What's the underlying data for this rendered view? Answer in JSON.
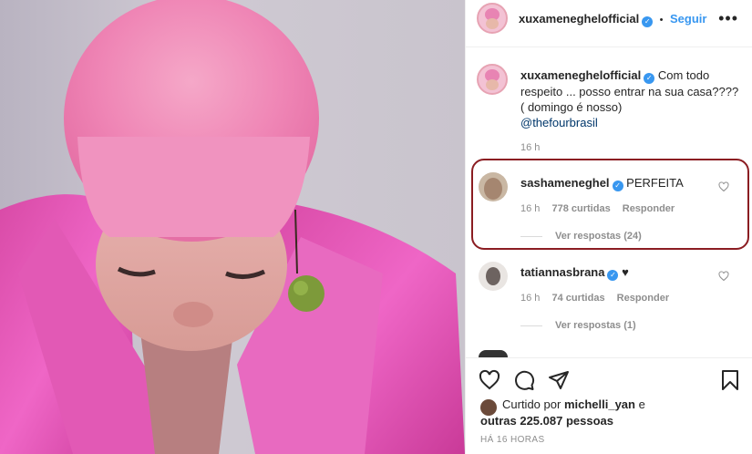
{
  "post": {
    "author": "xuxameneghelofficial",
    "follow_label": "Seguir",
    "more_label": "•••",
    "bullet": "•"
  },
  "caption": {
    "author": "xuxameneghelofficial",
    "text": "Com todo respeito ... posso entrar na sua casa???? ( domingo é nosso)",
    "mention": "@thefourbrasil",
    "time": "16 h"
  },
  "comments": [
    {
      "user": "sashameneghel",
      "verified": true,
      "text": "PERFEITA",
      "time": "16 h",
      "likes": "778 curtidas",
      "reply_label": "Responder",
      "view_replies": "Ver respostas (24)"
    },
    {
      "user": "tatiannasbrana",
      "verified": true,
      "text": "♥",
      "time": "16 h",
      "likes": "74 curtidas",
      "reply_label": "Responder",
      "view_replies": "Ver respostas (1)"
    }
  ],
  "likes": {
    "prefix": "Curtido por",
    "user": "michelli_yan",
    "connector": "e",
    "others": "outras 225.087 pessoas"
  },
  "timestamp": "HÁ 16 HORAS",
  "icons": [
    "heart-icon",
    "comment-icon",
    "share-icon",
    "bookmark-icon",
    "verified-icon",
    "more-options-icon"
  ],
  "colors": {
    "accent": "#3897f0",
    "highlight": "#8b1d22",
    "photo_pink": "#e8569f"
  }
}
